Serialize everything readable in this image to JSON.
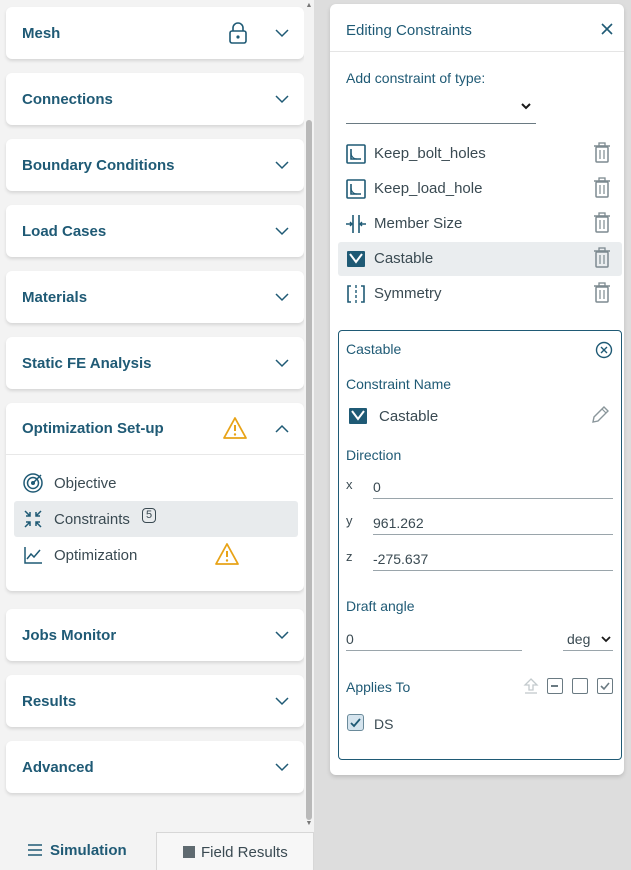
{
  "sidebar": {
    "sections": [
      {
        "title": "Mesh"
      },
      {
        "title": "Connections"
      },
      {
        "title": "Boundary Conditions"
      },
      {
        "title": "Load Cases"
      },
      {
        "title": "Materials"
      },
      {
        "title": "Static FE Analysis"
      },
      {
        "title": "Optimization Set-up"
      },
      {
        "title": "Jobs Monitor"
      },
      {
        "title": "Results"
      },
      {
        "title": "Advanced"
      }
    ],
    "optimization_items": [
      {
        "label": "Objective"
      },
      {
        "label": "Constraints",
        "badge": "5"
      },
      {
        "label": "Optimization"
      }
    ]
  },
  "bottom_tabs": {
    "simulation": "Simulation",
    "field_results": "Field Results"
  },
  "editor": {
    "title": "Editing Constraints",
    "add_label": "Add constraint of type:",
    "constraints": [
      {
        "label": "Keep_bolt_holes",
        "icon": "keep-region-icon"
      },
      {
        "label": "Keep_load_hole",
        "icon": "keep-region-icon"
      },
      {
        "label": "Member Size",
        "icon": "member-size-icon"
      },
      {
        "label": "Castable",
        "icon": "castable-icon"
      },
      {
        "label": "Symmetry",
        "icon": "symmetry-icon"
      }
    ],
    "detail": {
      "title": "Castable",
      "name_label": "Constraint Name",
      "name_value": "Castable",
      "direction_label": "Direction",
      "x_label": "x",
      "x_value": "0",
      "y_label": "y",
      "y_value": "961.262",
      "z_label": "z",
      "z_value": "-275.637",
      "draft_label": "Draft angle",
      "draft_value": "0",
      "unit": "deg",
      "applies_label": "Applies To",
      "applies_item": "DS"
    }
  },
  "colors": {
    "accent": "#1f5a75",
    "warning": "#e8a317",
    "selected_bg": "#e8ebed"
  }
}
